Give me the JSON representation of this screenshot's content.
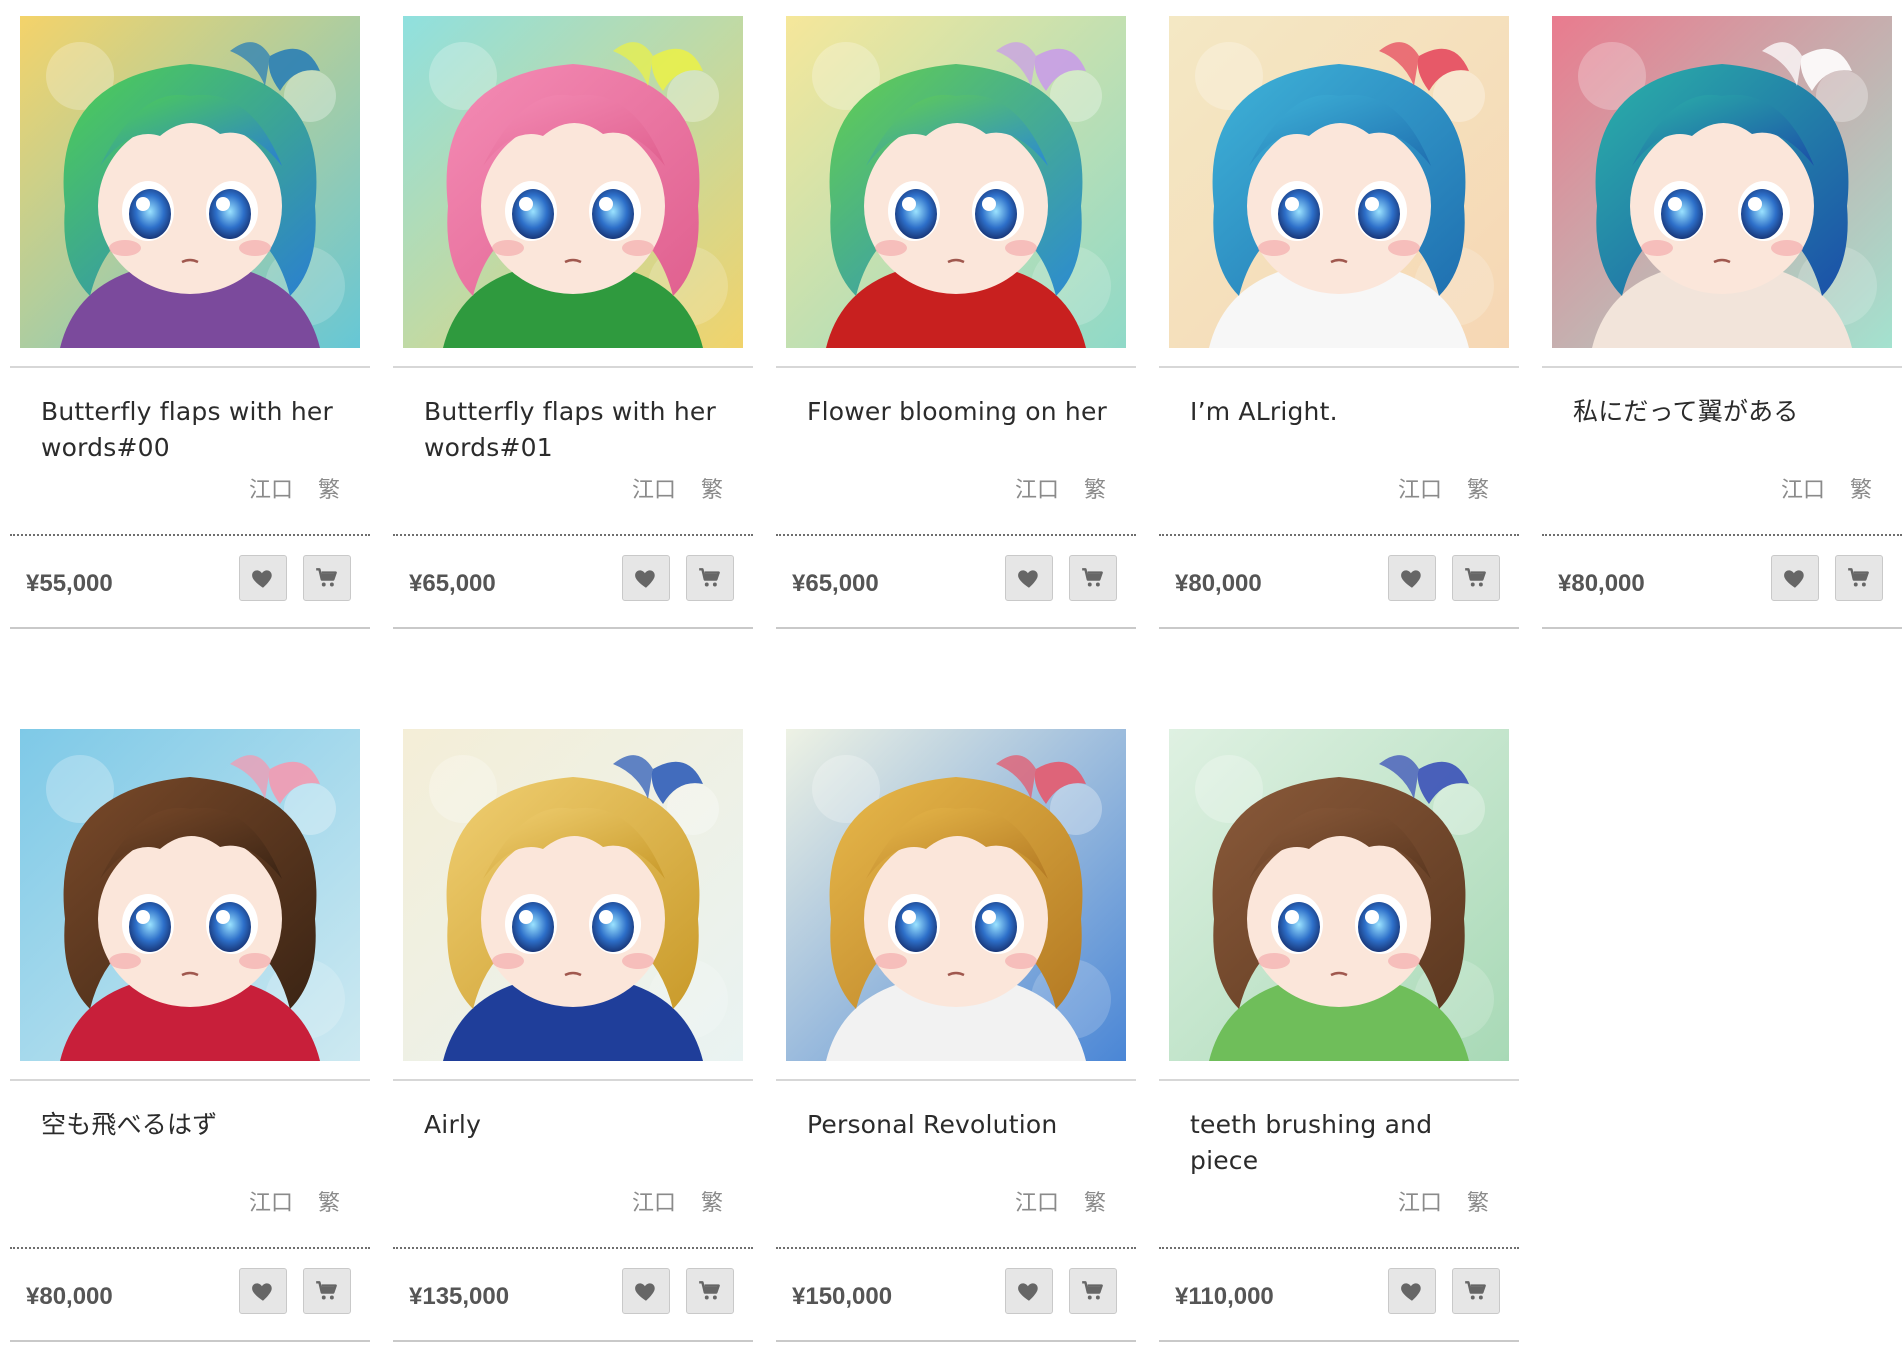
{
  "artworks": [
    {
      "title": "Butterfly flaps with her words#00",
      "artist": "江口 繁",
      "price": "¥55,000",
      "palette": {
        "bg1": "#f4d36a",
        "bg2": "#66c7d6",
        "hair1": "#4fcf52",
        "hair2": "#2a7fd1",
        "accent": "#2b7fb5",
        "cloth": "#7b4a9c"
      }
    },
    {
      "title": "Butterfly flaps with her words#01",
      "artist": "江口 繁",
      "price": "¥65,000",
      "palette": {
        "bg1": "#8fe0df",
        "bg2": "#f1d36b",
        "hair1": "#f48cb5",
        "hair2": "#e0608f",
        "accent": "#e9f04a",
        "cloth": "#2f9a3e"
      }
    },
    {
      "title": "Flower blooming on her",
      "artist": "江口 繁",
      "price": "¥65,000",
      "palette": {
        "bg1": "#f6e79a",
        "bg2": "#8fd9c8",
        "hair1": "#63d04e",
        "hair2": "#2b8ad2",
        "accent": "#c99de8",
        "cloth": "#c8201f"
      }
    },
    {
      "title": "I’m ALright.",
      "artist": "江口 繁",
      "price": "¥80,000",
      "palette": {
        "bg1": "#f4e8c4",
        "bg2": "#f6d7b4",
        "hair1": "#3fb3d8",
        "hair2": "#1f6fb0",
        "accent": "#e64a5e",
        "cloth": "#f7f7f7"
      }
    },
    {
      "title": "私にだって翼がある",
      "artist": "江口 繁",
      "price": "¥80,000",
      "palette": {
        "bg1": "#e97b8e",
        "bg2": "#a3e2cf",
        "hair1": "#2bb2a8",
        "hair2": "#1b4fa8",
        "accent": "#ffffff",
        "cloth": "#f2e4da"
      }
    },
    {
      "title": "空も飛べるはず",
      "artist": "江口 繁",
      "price": "¥80,000",
      "palette": {
        "bg1": "#7ec9e7",
        "bg2": "#cde9f1",
        "hair1": "#7a4a2a",
        "hair2": "#3b2414",
        "accent": "#f39ab1",
        "cloth": "#c81f3a"
      }
    },
    {
      "title": "Airly",
      "artist": "江口 繁",
      "price": "¥135,000",
      "palette": {
        "bg1": "#f4eed7",
        "bg2": "#e9f3f2",
        "hair1": "#f0cf72",
        "hair2": "#c99a2a",
        "accent": "#2f5db8",
        "cloth": "#1f3e9a"
      }
    },
    {
      "title": "Personal Revolution",
      "artist": "江口 繁",
      "price": "¥150,000",
      "palette": {
        "bg1": "#eef2e4",
        "bg2": "#4a86d6",
        "hair1": "#e8b94b",
        "hair2": "#b47a23",
        "accent": "#e45a6e",
        "cloth": "#f2f2f2"
      }
    },
    {
      "title": "teeth brushing and piece",
      "artist": "江口 繁",
      "price": "¥110,000",
      "palette": {
        "bg1": "#dff1e2",
        "bg2": "#a8d9b6",
        "hair1": "#8a5a3a",
        "hair2": "#5c3820",
        "accent": "#3b51b8",
        "cloth": "#6fbe5a"
      }
    }
  ],
  "icons": {
    "favorite": "heart-icon",
    "cart": "cart-icon"
  }
}
